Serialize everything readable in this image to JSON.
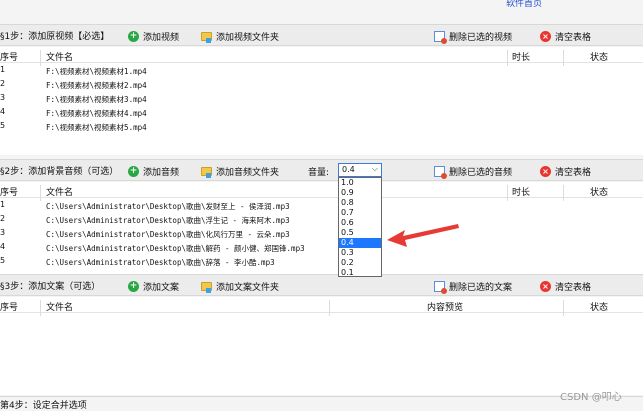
{
  "top_link": "软件首页",
  "step1": {
    "label": "§1步：添加原视频【必选】",
    "add": "添加视频",
    "add_folder": "添加视频文件夹",
    "delete_selected": "删除已选的视频",
    "clear": "清空表格",
    "columns": [
      "序号",
      "文件名",
      "时长",
      "状态"
    ],
    "rows": [
      {
        "idx": "1",
        "name": "F:\\视频素材\\视频素材1.mp4"
      },
      {
        "idx": "2",
        "name": "F:\\视频素材\\视频素材2.mp4"
      },
      {
        "idx": "3",
        "name": "F:\\视频素材\\视频素材3.mp4"
      },
      {
        "idx": "4",
        "name": "F:\\视频素材\\视频素材4.mp4"
      },
      {
        "idx": "5",
        "name": "F:\\视频素材\\视频素材5.mp4"
      }
    ]
  },
  "step2": {
    "label": "§2步：添加背景音频（可选）",
    "add": "添加音频",
    "add_folder": "添加音频文件夹",
    "volume_label": "音量:",
    "volume_value": "0.4",
    "volume_options": [
      "1.0",
      "0.9",
      "0.8",
      "0.7",
      "0.6",
      "0.5",
      "0.4",
      "0.3",
      "0.2",
      "0.1"
    ],
    "volume_selected": "0.4",
    "delete_selected": "删除已选的音频",
    "clear": "清空表格",
    "columns": [
      "序号",
      "文件名",
      "时长",
      "状态"
    ],
    "rows": [
      {
        "idx": "1",
        "name": "C:\\Users\\Administrator\\Desktop\\歌曲\\发财至上 - 侯泽润.mp3"
      },
      {
        "idx": "2",
        "name": "C:\\Users\\Administrator\\Desktop\\歌曲\\浮生记 - 海来阿木.mp3"
      },
      {
        "idx": "3",
        "name": "C:\\Users\\Administrator\\Desktop\\歌曲\\化风行万里 - 云朵.mp3"
      },
      {
        "idx": "4",
        "name": "C:\\Users\\Administrator\\Desktop\\歌曲\\解药 - 颜小健、郑国锋.mp3"
      },
      {
        "idx": "5",
        "name": "C:\\Users\\Administrator\\Desktop\\歌曲\\辞落 - 李小酷.mp3"
      }
    ]
  },
  "step3": {
    "label": "§3步：添加文案（可选）",
    "add": "添加文案",
    "add_folder": "添加文案文件夹",
    "delete_selected": "删除已选的文案",
    "clear": "清空表格",
    "columns": [
      "序号",
      "文件名",
      "内容预览",
      "状态"
    ]
  },
  "step4": {
    "label": "第4步：设定合并选项"
  },
  "watermark": "CSDN @叩心"
}
